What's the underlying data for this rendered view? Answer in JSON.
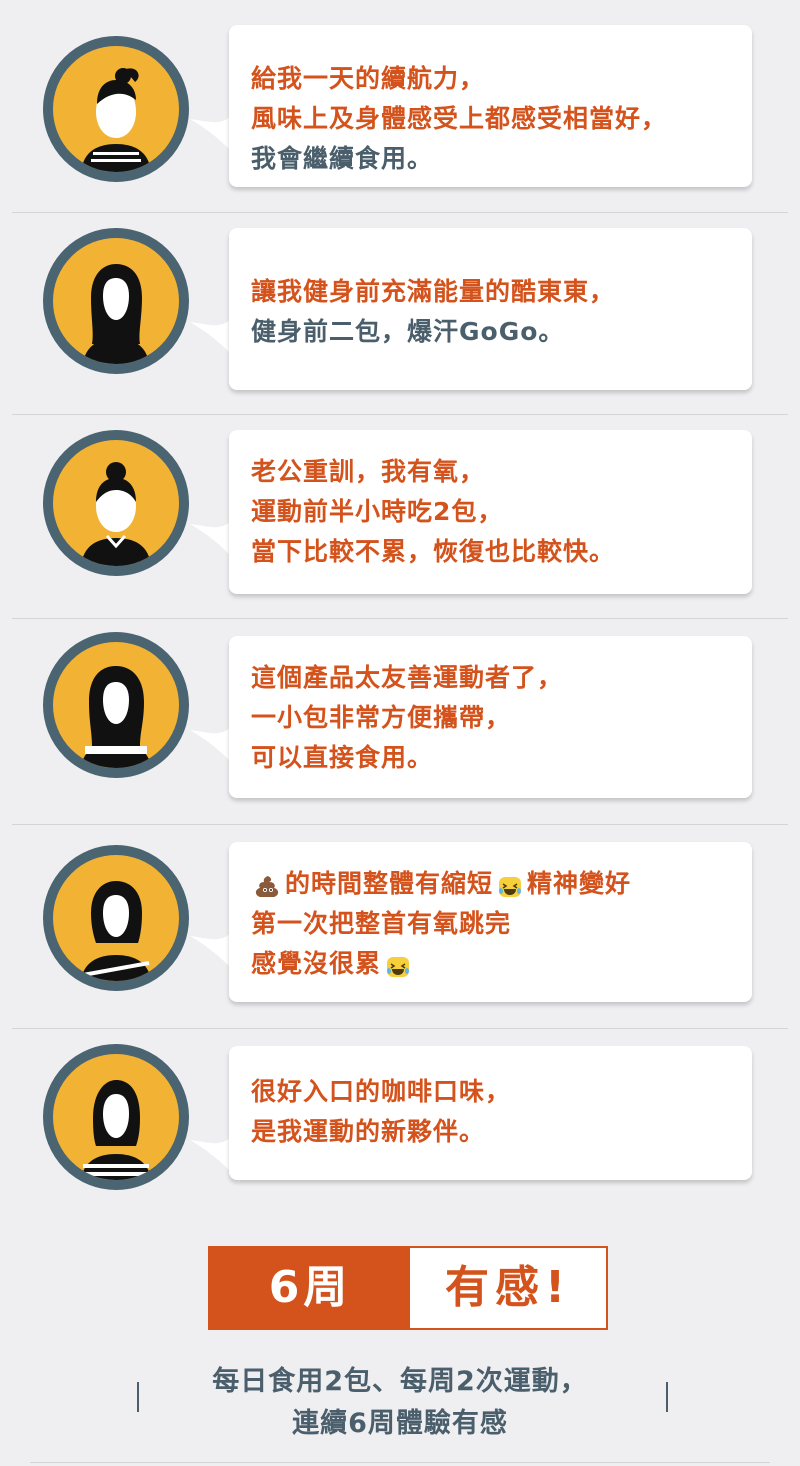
{
  "testimonials": [
    {
      "avatar_icon": "woman-ponytail-avatar-icon",
      "lines": [
        {
          "text": "給我一天的續航力，",
          "tone": "orange"
        },
        {
          "text": "風味上及身體感受上都感受相當好，",
          "tone": "orange"
        },
        {
          "text": "我會繼續食用。",
          "tone": "slate"
        }
      ]
    },
    {
      "avatar_icon": "woman-long-hair-avatar-icon",
      "lines": [
        {
          "text": "讓我健身前充滿能量的酷東東，",
          "tone": "orange"
        },
        {
          "text": "健身前二包，爆汗GoGo。",
          "tone": "slate"
        }
      ]
    },
    {
      "avatar_icon": "woman-bun-avatar-icon",
      "lines": [
        {
          "text": "老公重訓，我有氧，",
          "tone": "orange"
        },
        {
          "text": "運動前半小時吃2包，",
          "tone": "orange"
        },
        {
          "text": "當下比較不累，恢復也比較快。",
          "tone": "orange"
        }
      ]
    },
    {
      "avatar_icon": "woman-wavy-hair-avatar-icon",
      "lines": [
        {
          "text": "這個產品太友善運動者了，",
          "tone": "orange"
        },
        {
          "text": "一小包非常方便攜帶，",
          "tone": "orange"
        },
        {
          "text": "可以直接食用。",
          "tone": "orange"
        }
      ]
    },
    {
      "avatar_icon": "woman-bob-hair-avatar-icon",
      "lines": [
        {
          "segments": [
            {
              "emoji": "poop-emoji-icon"
            },
            {
              "text": "的時間整體有縮短"
            },
            {
              "emoji": "laughing-tears-emoji-icon"
            },
            {
              "text": "精神變好"
            }
          ],
          "tone": "orange"
        },
        {
          "text": "第一次把整首有氧跳完",
          "tone": "orange"
        },
        {
          "segments": [
            {
              "text": "感覺沒很累"
            },
            {
              "emoji": "laughing-tears-emoji-icon"
            }
          ],
          "tone": "orange"
        }
      ]
    },
    {
      "avatar_icon": "woman-short-hair-avatar-icon",
      "lines": [
        {
          "text": "很好入口的咖啡口味，",
          "tone": "orange"
        },
        {
          "text": "是我運動的新夥伴。",
          "tone": "orange"
        }
      ]
    }
  ],
  "badge": {
    "left": "6周",
    "right": "有感!"
  },
  "footer": {
    "line1": "每日食用2包、每周2次運動，",
    "line2": "連續6周體驗有感"
  },
  "colors": {
    "orange": "#d4531c",
    "slate": "#4a5f6b",
    "avatar_bg": "#f2b233",
    "avatar_ring": "#4a6472"
  }
}
